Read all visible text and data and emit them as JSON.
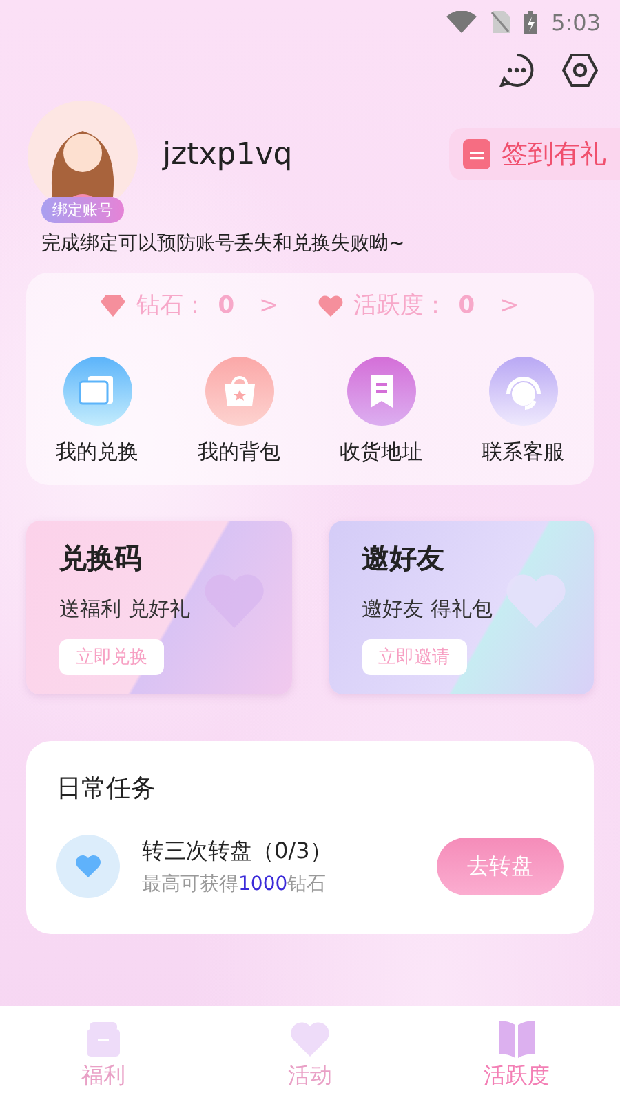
{
  "status_bar": {
    "time": "5:03"
  },
  "profile": {
    "username": "jztxp1vq",
    "bind_label": "绑定账号",
    "hint": "完成绑定可以预防账号丢失和兑换失败呦~",
    "checkin_label": "签到有礼"
  },
  "stats": [
    {
      "label": "钻石：",
      "value": "0",
      "chevron": ">"
    },
    {
      "label": "活跃度：",
      "value": "0",
      "chevron": ">"
    }
  ],
  "shortcuts": [
    {
      "label": "我的兑换",
      "kind": "exchange"
    },
    {
      "label": "我的背包",
      "kind": "bag"
    },
    {
      "label": "收货地址",
      "kind": "address"
    },
    {
      "label": "联系客服",
      "kind": "service"
    }
  ],
  "promos": [
    {
      "title": "兑换码",
      "subtitle": "送福利 兑好礼",
      "button": "立即兑换",
      "kind": "pink"
    },
    {
      "title": "邀好友",
      "subtitle": "邀好友 得礼包",
      "button": "立即邀请",
      "kind": "violet"
    }
  ],
  "daily_tasks": {
    "title": "日常任务",
    "tasks": [
      {
        "name": "转三次转盘（0/3）",
        "reward_before": "最高可获得",
        "reward_value": "1000",
        "reward_after": "钻石",
        "button": "去转盘"
      }
    ]
  },
  "bottom_nav": [
    {
      "label": "福利",
      "kind": "gift",
      "selected": false
    },
    {
      "label": "活动",
      "kind": "heart",
      "selected": false
    },
    {
      "label": "活跃度",
      "kind": "book",
      "selected": true
    }
  ]
}
